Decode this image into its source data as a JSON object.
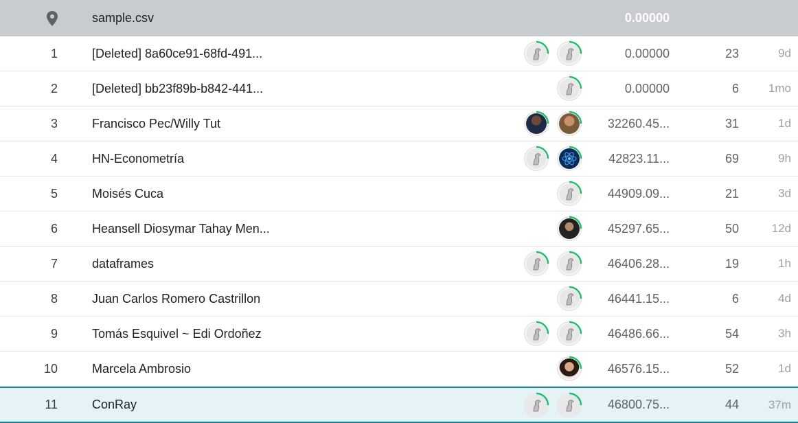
{
  "header": {
    "pin_icon": "map-pin-icon",
    "name": "sample.csv",
    "score": "0.00000"
  },
  "rows": [
    {
      "rank": "1",
      "name": "[Deleted] 8a60ce91-68fd-491...",
      "score": "0.00000",
      "entries": "23",
      "last": "9d"
    },
    {
      "rank": "2",
      "name": "[Deleted] bb23f89b-b842-441...",
      "score": "0.00000",
      "entries": "6",
      "last": "1mo"
    },
    {
      "rank": "3",
      "name": "Francisco Pec/Willy Tut",
      "score": "32260.45...",
      "entries": "31",
      "last": "1d"
    },
    {
      "rank": "4",
      "name": "HN-Econometría",
      "score": "42823.11...",
      "entries": "69",
      "last": "9h"
    },
    {
      "rank": "5",
      "name": "Moisés Cuca",
      "score": "44909.09...",
      "entries": "21",
      "last": "3d"
    },
    {
      "rank": "6",
      "name": "Heansell Diosymar Tahay Men...",
      "score": "45297.65...",
      "entries": "50",
      "last": "12d"
    },
    {
      "rank": "7",
      "name": "dataframes",
      "score": "46406.28...",
      "entries": "19",
      "last": "1h"
    },
    {
      "rank": "8",
      "name": "Juan Carlos Romero Castrillon",
      "score": "46441.15...",
      "entries": "6",
      "last": "4d"
    },
    {
      "rank": "9",
      "name": "Tomás Esquivel ~ Edi Ordoñez",
      "score": "46486.66...",
      "entries": "54",
      "last": "3h"
    },
    {
      "rank": "10",
      "name": "Marcela Ambrosio",
      "score": "46576.15...",
      "entries": "52",
      "last": "1d"
    },
    {
      "rank": "11",
      "name": "ConRay",
      "score": "46800.75...",
      "entries": "44",
      "last": "37m"
    }
  ],
  "colors": {
    "header_bg": "#c8ccd0",
    "highlight_bg": "#e5f3f7",
    "highlight_border": "#1a7f98",
    "progress_ring": "#20be6a"
  }
}
